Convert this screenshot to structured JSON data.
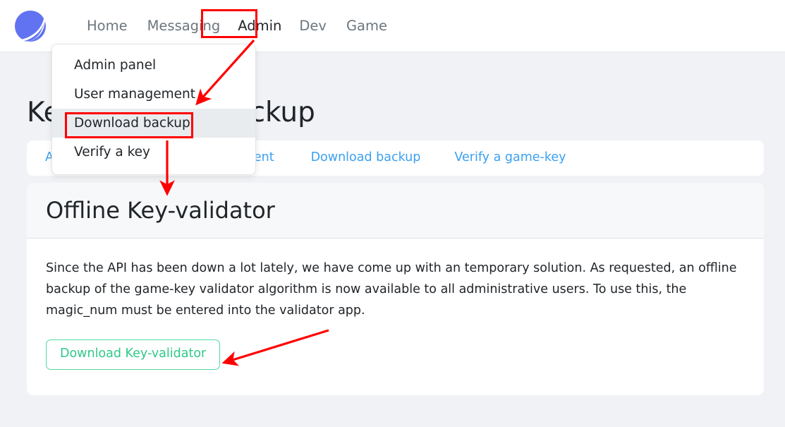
{
  "brand": {
    "icon": "app-logo-icon",
    "color": "#6173f0"
  },
  "navbar": {
    "links": [
      {
        "label": "Home",
        "active": false
      },
      {
        "label": "Messaging",
        "active": false
      },
      {
        "label": "Admin",
        "active": true
      },
      {
        "label": "Dev",
        "active": false
      },
      {
        "label": "Game",
        "active": false
      }
    ]
  },
  "dropdown": {
    "items": [
      {
        "label": "Admin panel",
        "highlighted": false
      },
      {
        "label": "User management",
        "highlighted": false
      },
      {
        "label": "Download backup",
        "highlighted": true
      },
      {
        "label": "Verify a key",
        "highlighted": false
      }
    ]
  },
  "page": {
    "title": "Key-validator backup"
  },
  "tabs": [
    {
      "label": "Admin panel"
    },
    {
      "label": "User management"
    },
    {
      "label": "Download backup"
    },
    {
      "label": "Verify a game-key"
    }
  ],
  "card": {
    "header_title": "Offline Key-validator",
    "body_text": "Since the API has been down a lot lately, we have come up with an temporary solution. As requested, an offline backup of the game-key validator algorithm is now available to all administrative users. To use this, the magic_num must be entered into the validator app.",
    "download_button": "Download Key-validator",
    "button_color": "#2fc98a"
  },
  "annotations": {
    "color": "#ff0000",
    "boxes": [
      {
        "name": "admin-nav-highlight"
      },
      {
        "name": "download-backup-menu-highlight"
      }
    ],
    "arrows": [
      {
        "name": "arrow-admin-to-menu"
      },
      {
        "name": "arrow-menu-to-page"
      },
      {
        "name": "arrow-to-download-button"
      }
    ]
  }
}
